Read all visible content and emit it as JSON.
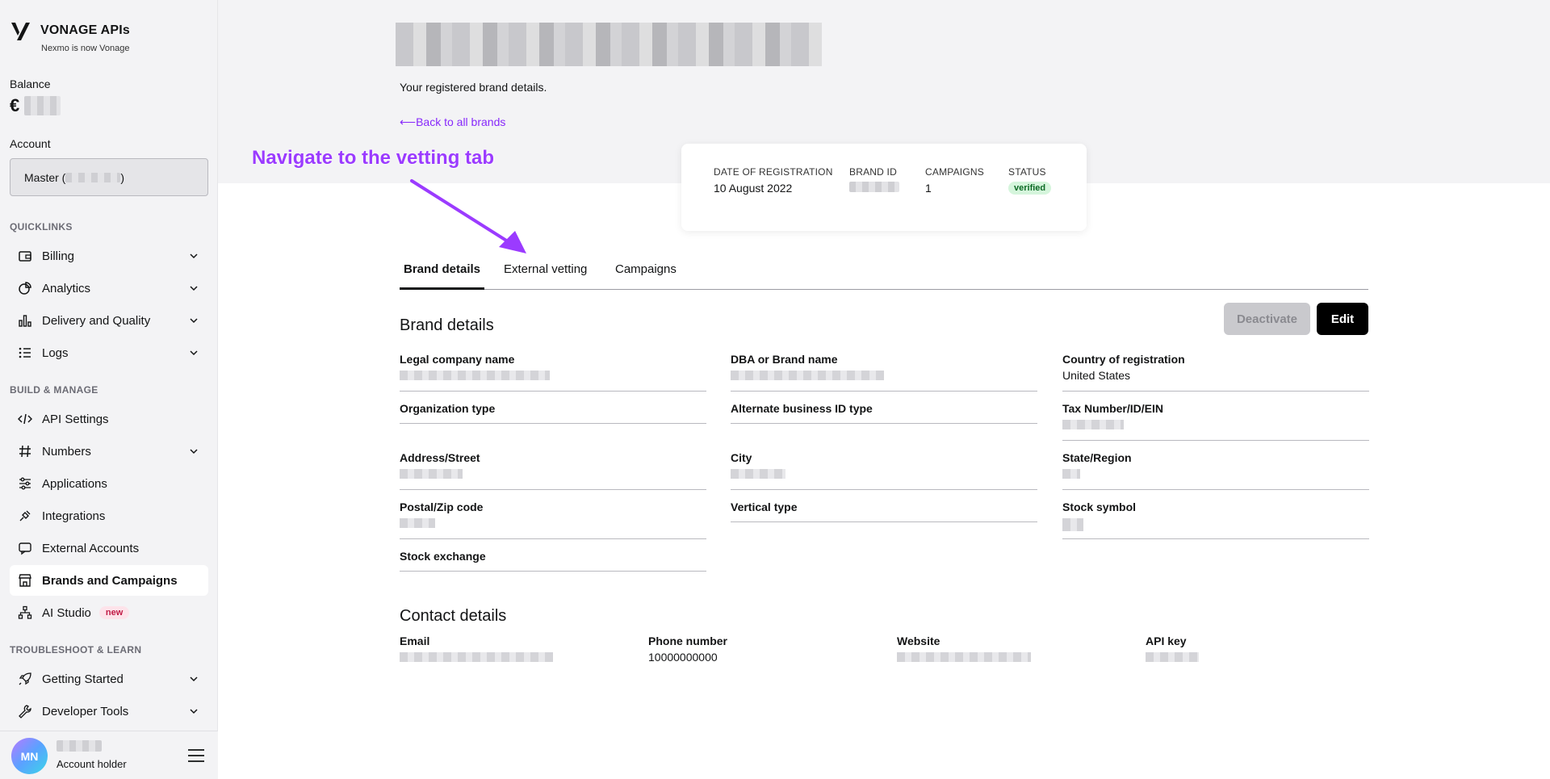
{
  "sidebar": {
    "brand": "VONAGE APIs",
    "brand_sub": "Nexmo is now Vonage",
    "balance_label": "Balance",
    "currency": "€",
    "account_label": "Account",
    "account_value": "Master (",
    "account_value_end": ")",
    "sections": {
      "quicklinks": "QUICKLINKS",
      "build": "BUILD & MANAGE",
      "troubleshoot": "TROUBLESHOOT & LEARN"
    },
    "items": {
      "billing": "Billing",
      "analytics": "Analytics",
      "delivery": "Delivery and Quality",
      "logs": "Logs",
      "api_settings": "API Settings",
      "numbers": "Numbers",
      "applications": "Applications",
      "integrations": "Integrations",
      "external_accounts": "External Accounts",
      "brands": "Brands and Campaigns",
      "ai_studio": "AI Studio",
      "ai_badge": "new",
      "getting_started": "Getting Started",
      "developer_tools": "Developer Tools"
    },
    "user": {
      "initials": "MN",
      "role": "Account holder"
    }
  },
  "header": {
    "subtitle": "Your registered brand details.",
    "back_link": "Back to all brands"
  },
  "summary": {
    "date_label": "DATE OF REGISTRATION",
    "date_value": "10 August 2022",
    "brand_id_label": "BRAND ID",
    "campaigns_label": "CAMPAIGNS",
    "campaigns_value": "1",
    "status_label": "STATUS",
    "status_value": "verified"
  },
  "annotation": "Navigate to the vetting tab",
  "tabs": {
    "brand_details": "Brand details",
    "external_vetting": "External vetting",
    "campaigns": "Campaigns"
  },
  "brand_section": {
    "title": "Brand details",
    "deactivate": "Deactivate",
    "edit": "Edit",
    "fields": {
      "legal_name": "Legal company name",
      "dba": "DBA or Brand name",
      "country": "Country of registration",
      "country_value": "United States",
      "org_type": "Organization type",
      "alt_id": "Alternate business ID type",
      "tax": "Tax Number/ID/EIN",
      "address": "Address/Street",
      "city": "City",
      "state": "State/Region",
      "postal": "Postal/Zip code",
      "vertical": "Vertical type",
      "stock_symbol": "Stock symbol",
      "stock_exchange": "Stock exchange"
    }
  },
  "contact_section": {
    "title": "Contact details",
    "email": "Email",
    "phone": "Phone number",
    "phone_value": "10000000000",
    "website": "Website",
    "api_key": "API key"
  }
}
